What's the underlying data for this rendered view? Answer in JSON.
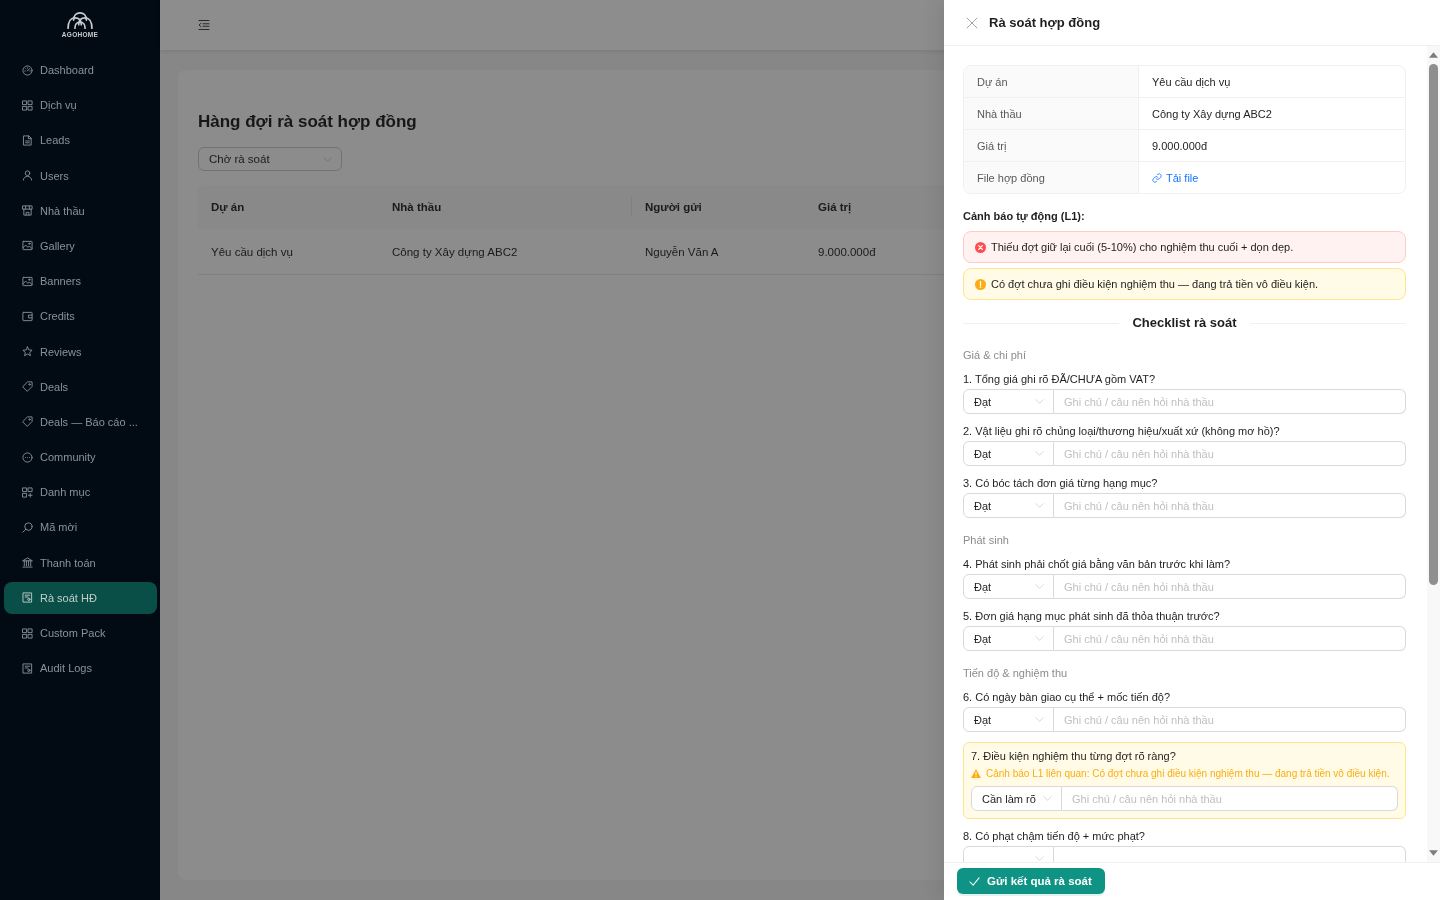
{
  "sidebar": {
    "logo": "AGOHOME",
    "items": [
      {
        "label": "Dashboard",
        "selected": false
      },
      {
        "label": "Dịch vụ",
        "selected": false
      },
      {
        "label": "Leads",
        "selected": false
      },
      {
        "label": "Users",
        "selected": false
      },
      {
        "label": "Nhà thầu",
        "selected": false
      },
      {
        "label": "Gallery",
        "selected": false
      },
      {
        "label": "Banners",
        "selected": false
      },
      {
        "label": "Credits",
        "selected": false
      },
      {
        "label": "Reviews",
        "selected": false
      },
      {
        "label": "Deals",
        "selected": false
      },
      {
        "label": "Deals — Báo cáo ...",
        "selected": false
      },
      {
        "label": "Community",
        "selected": false
      },
      {
        "label": "Danh mục",
        "selected": false
      },
      {
        "label": "Mã mời",
        "selected": false
      },
      {
        "label": "Thanh toán",
        "selected": false
      },
      {
        "label": "Rà soát HĐ",
        "selected": true
      },
      {
        "label": "Custom Pack",
        "selected": false
      },
      {
        "label": "Audit Logs",
        "selected": false
      }
    ]
  },
  "page": {
    "title": "Hàng đợi rà soát hợp đồng",
    "status_filter": {
      "value": "Chờ rà soát"
    },
    "table": {
      "columns": [
        "Dự án",
        "Nhà thầu",
        "Người gửi",
        "Giá trị"
      ],
      "rows": [
        [
          "Yêu cầu dịch vụ",
          "Công ty Xây dựng ABC2",
          "Nguyễn Văn A",
          "9.000.000đ"
        ]
      ]
    }
  },
  "drawer": {
    "title": "Rà soát hợp đồng",
    "details": [
      {
        "label": "Dự án",
        "value": "Yêu cầu dịch vụ",
        "kind": "text"
      },
      {
        "label": "Nhà thầu",
        "value": "Công ty Xây dựng ABC2",
        "kind": "text"
      },
      {
        "label": "Giá trị",
        "value": "9.000.000đ",
        "kind": "text"
      },
      {
        "label": "File hợp đồng",
        "value": "Tải file",
        "kind": "link"
      }
    ],
    "alerts_heading": "Cảnh báo tự động (L1):",
    "alerts": [
      {
        "kind": "error",
        "text": "Thiếu đợt giữ lại cuối (5-10%) cho nghiệm thu cuối + dọn dẹp."
      },
      {
        "kind": "warning",
        "text": "Có đợt chưa ghi điều kiện nghiệm thu — đang trả tiền vô điều kiện."
      }
    ],
    "checklist_title": "Checklist rà soát",
    "sections": [
      {
        "title": "Giá & chi phí",
        "items": [
          {
            "kind": "plain",
            "question": "1. Tổng giá ghi rõ ĐÃ/CHƯA gồm VAT?",
            "result": "Đạt",
            "placeholder": "Ghi chú / câu nên hỏi nhà thầu"
          },
          {
            "kind": "plain",
            "question": "2. Vật liệu ghi rõ chủng loại/thương hiệu/xuất xứ (không mơ hồ)?",
            "result": "Đạt",
            "placeholder": "Ghi chú / câu nên hỏi nhà thầu"
          },
          {
            "kind": "plain",
            "question": "3. Có bóc tách đơn giá từng hạng mục?",
            "result": "Đạt",
            "placeholder": "Ghi chú / câu nên hỏi nhà thầu"
          }
        ]
      },
      {
        "title": "Phát sinh",
        "items": [
          {
            "kind": "plain",
            "question": "4. Phát sinh phải chốt giá bằng văn bản trước khi làm?",
            "result": "Đạt",
            "placeholder": "Ghi chú / câu nên hỏi nhà thầu"
          },
          {
            "kind": "plain",
            "question": "5. Đơn giá hạng mục phát sinh đã thỏa thuận trước?",
            "result": "Đạt",
            "placeholder": "Ghi chú / câu nên hỏi nhà thầu"
          }
        ]
      },
      {
        "title": "Tiến độ & nghiệm thu",
        "items": [
          {
            "kind": "plain",
            "question": "6. Có ngày bàn giao cụ thể + mốc tiến độ?",
            "result": "Đạt",
            "placeholder": "Ghi chú / câu nên hỏi nhà thầu"
          },
          {
            "kind": "flagged",
            "question": "7. Điều kiện nghiệm thu từng đợt rõ ràng?",
            "warning": "Cảnh báo L1 liên quan: Có đợt chưa ghi điều kiện nghiệm thu — đang trả tiền vô điều kiện.",
            "result": "Cần làm rõ",
            "placeholder": "Ghi chú / câu nên hỏi nhà thầu"
          },
          {
            "kind": "plain",
            "question": "8. Có phạt chậm tiến độ + mức phạt?"
          }
        ]
      }
    ],
    "submit_button": "Gửi kết quả rà soát"
  }
}
